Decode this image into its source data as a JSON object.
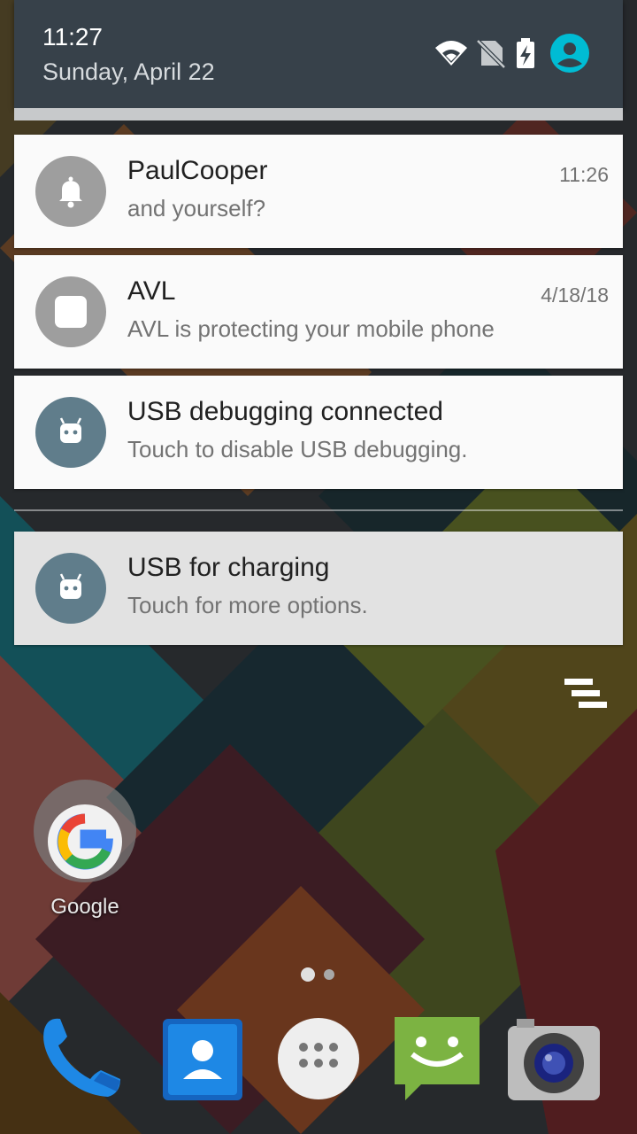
{
  "status_header": {
    "time": "11:27",
    "date": "Sunday, April 22",
    "icons": [
      "wifi-icon",
      "no-sim-icon",
      "battery-charging-icon",
      "user-account-icon"
    ]
  },
  "notifications": [
    {
      "app": "PaulCooper",
      "text": "and yourself?",
      "time": "11:26",
      "icon": "bell-icon",
      "icon_color": "#9e9e9e"
    },
    {
      "app": "AVL",
      "text": "AVL is protecting your mobile phone",
      "time": "4/18/18",
      "icon": "avl-app-icon",
      "icon_color": "#9e9e9e"
    },
    {
      "app": "USB debugging connected",
      "text": "Touch to disable USB debugging.",
      "time": "",
      "icon": "android-icon",
      "icon_color": "#607d8b"
    },
    {
      "app": "USB for charging",
      "text": "Touch for more options.",
      "time": "",
      "icon": "android-icon",
      "icon_color": "#607d8b"
    }
  ],
  "clear_all": {
    "icon": "clear-all-icon"
  },
  "home": {
    "app_label": "Google",
    "dock": [
      "phone-icon",
      "contacts-icon",
      "app-drawer-icon",
      "messaging-icon",
      "camera-icon"
    ]
  },
  "colors": {
    "header_bg": "#37414a",
    "notification_bg": "#fafafa",
    "pinned_notification_bg": "#e2e2e2",
    "accent": "#00bcd4"
  }
}
